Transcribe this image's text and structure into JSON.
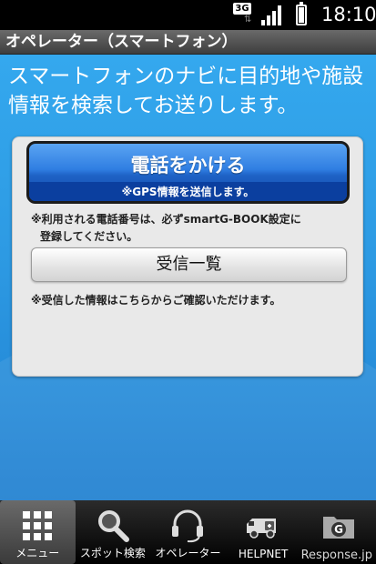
{
  "status": {
    "network": "3G",
    "time": "18:10"
  },
  "titlebar": {
    "title": "オペレーター（スマートフォン）"
  },
  "content": {
    "headline_line1": "スマートフォンのナビに目的地や施設",
    "headline_line2": "情報を検索してお送りします。",
    "call_button": {
      "label": "電話をかける",
      "sublabel": "※GPS情報を送信します。"
    },
    "note1_line1": "※利用される電話番号は、必ずsmartG-BOOK設定に",
    "note1_line2": "登録してください。",
    "inbox_button": {
      "label": "受信一覧"
    },
    "note2": "※受信した情報はこちらからご確認いただけます。"
  },
  "bottomnav": {
    "items": [
      {
        "label": "メニュー",
        "icon": "grid-icon",
        "active": true
      },
      {
        "label": "スポット検索",
        "icon": "magnifier-icon",
        "active": false
      },
      {
        "label": "オペレーター",
        "icon": "headset-icon",
        "active": false
      },
      {
        "label": "HELPNET",
        "icon": "ambulance-icon",
        "active": false
      },
      {
        "label": "G",
        "icon": "g-folder-icon",
        "active": false
      }
    ]
  },
  "watermark": "Response.jp",
  "colors": {
    "content_blue": "#2d9ae3",
    "call_button_blue": "#1f63c6",
    "titlebar_gray": "#4e4e4e"
  }
}
